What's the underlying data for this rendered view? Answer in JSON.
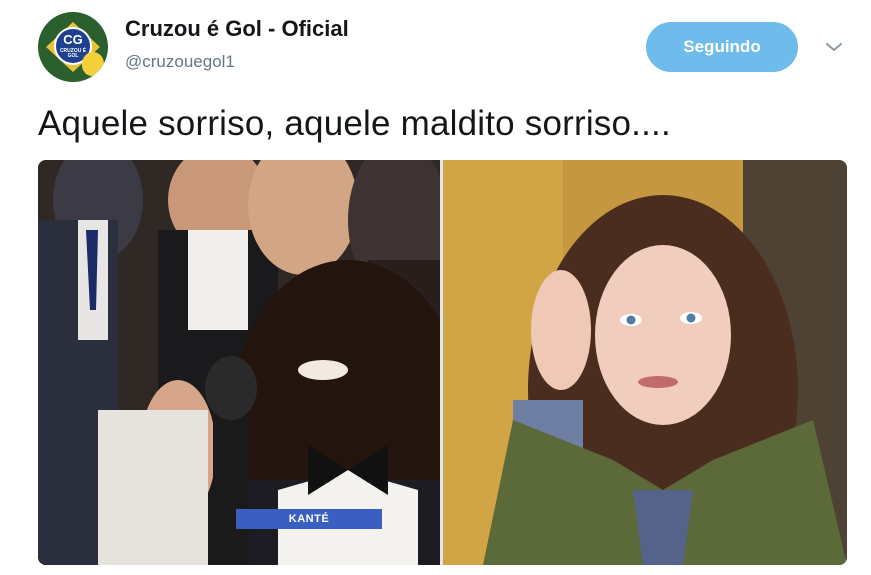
{
  "author": {
    "display_name": "Cruzou é Gol - Oficial",
    "handle": "@cruzouegol1",
    "avatar_monogram": "CG",
    "avatar_subtext": "CRUZOU É GOL"
  },
  "actions": {
    "follow_label": "Seguindo",
    "menu_icon": "chevron-down-icon"
  },
  "tweet": {
    "text": "Aquele sorriso, aquele maldito sorriso...."
  },
  "media": {
    "left_caption": "KANTÉ"
  },
  "colors": {
    "follow_button": "#6ebbec",
    "handle_text": "#657786",
    "caption_bar": "#3b5fc0"
  }
}
